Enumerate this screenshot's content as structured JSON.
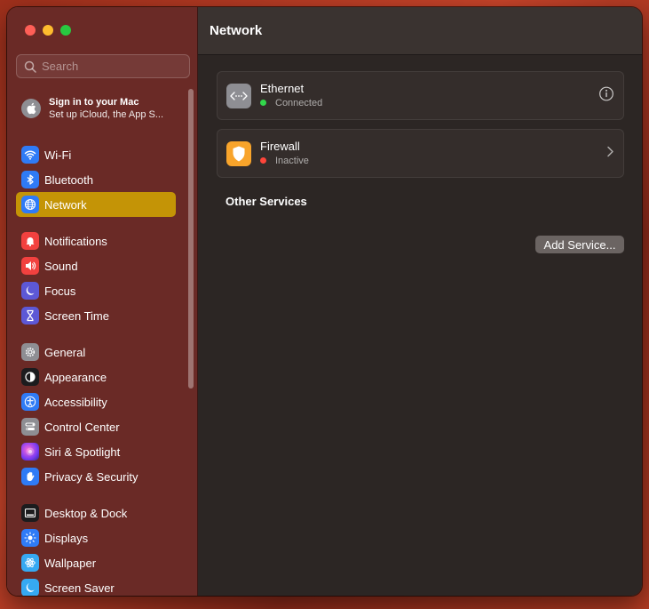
{
  "window": {
    "title": "Network"
  },
  "search": {
    "placeholder": "Search"
  },
  "account": {
    "title": "Sign in to your Mac",
    "subtitle": "Set up iCloud, the App S..."
  },
  "sidebar": {
    "active_color": "#c49406",
    "groups": [
      [
        {
          "label": "Wi-Fi",
          "icon": "wifi-icon",
          "color": "#2f7bf6"
        },
        {
          "label": "Bluetooth",
          "icon": "bluetooth-icon",
          "color": "#2f7bf6"
        },
        {
          "label": "Network",
          "icon": "globe-icon",
          "color": "#2f7bf6",
          "active": true
        }
      ],
      [
        {
          "label": "Notifications",
          "icon": "bell-icon",
          "color": "#f2413f"
        },
        {
          "label": "Sound",
          "icon": "speaker-icon",
          "color": "#f2413f"
        },
        {
          "label": "Focus",
          "icon": "moon-icon",
          "color": "#5d58d6"
        },
        {
          "label": "Screen Time",
          "icon": "hourglass-icon",
          "color": "#5d58d6"
        }
      ],
      [
        {
          "label": "General",
          "icon": "gear-icon",
          "color": "#8e8e93"
        },
        {
          "label": "Appearance",
          "icon": "appearance-icon",
          "color": "#1c1c1e"
        },
        {
          "label": "Accessibility",
          "icon": "accessibility-icon",
          "color": "#2f7bf6"
        },
        {
          "label": "Control Center",
          "icon": "control-center-icon",
          "color": "#8e8e93"
        },
        {
          "label": "Siri & Spotlight",
          "icon": "siri-icon",
          "color": "#c43ad6"
        },
        {
          "label": "Privacy & Security",
          "icon": "hand-icon",
          "color": "#2f7bf6"
        }
      ],
      [
        {
          "label": "Desktop & Dock",
          "icon": "dock-icon",
          "color": "#1c1c1e"
        },
        {
          "label": "Displays",
          "icon": "sun-icon",
          "color": "#2f7bf6"
        },
        {
          "label": "Wallpaper",
          "icon": "flower-icon",
          "color": "#36a9f2"
        },
        {
          "label": "Screen Saver",
          "icon": "screensaver-icon",
          "color": "#36a9f2"
        }
      ]
    ]
  },
  "services": [
    {
      "name": "Ethernet",
      "status": "Connected",
      "status_color": "#32d74b",
      "icon": "ethernet-icon",
      "action": "info-icon"
    },
    {
      "name": "Firewall",
      "status": "Inactive",
      "status_color": "#ff453a",
      "icon": "shield-icon",
      "action": "chevron-right-icon"
    }
  ],
  "other_services": {
    "title": "Other Services",
    "add_button": "Add Service..."
  }
}
